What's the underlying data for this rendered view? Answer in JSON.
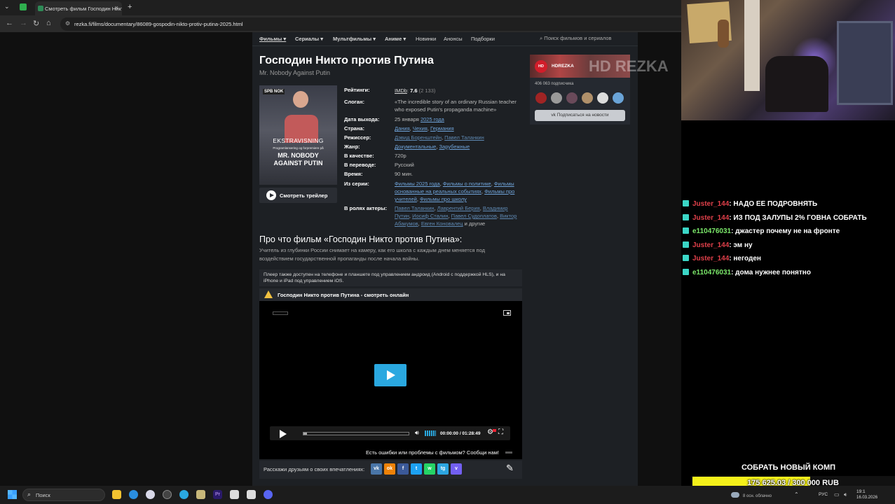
{
  "browser": {
    "tab_title": "Смотреть фильм Господин Никто",
    "url": "rezka.fi/films/documentary/86089-gospodin-nikto-protiv-putina-2025.html",
    "new_tab": "+",
    "tab_close": "×"
  },
  "site": {
    "nav": [
      {
        "label": "Фильмы ▾",
        "bold": true,
        "active": true
      },
      {
        "label": "Сериалы ▾",
        "bold": true
      },
      {
        "label": "Мультфильмы ▾",
        "bold": true
      },
      {
        "label": "Аниме ▾",
        "bold": true
      },
      {
        "label": "Новинки"
      },
      {
        "label": "Анонсы"
      },
      {
        "label": "Подборки"
      }
    ],
    "search_placeholder": "Поиск фильмов и сериалов",
    "title": "Господин Никто против Путина",
    "original_title": "Mr. Nobody Against Putin",
    "poster": {
      "channel": "SPB NOK",
      "line1": "EKSTRAVISNING",
      "line2": "Programlansering og forpremiere på",
      "line3a": "MR. NOBODY",
      "line3b": "AGAINST PUTIN"
    },
    "trailer_button": "Смотреть трейлер",
    "info": {
      "ratings_label": "Рейтинги:",
      "imdb_label": "IMDb",
      "imdb_score": "7.6",
      "imdb_votes": "(2 133)",
      "slogan_label": "Слоган:",
      "slogan": "«The incredible story of an ordinary Russian teacher who exposed Putin's propaganda machine»",
      "date_label": "Дата выхода:",
      "date_day": "25 января",
      "date_year": "2025 года",
      "country_label": "Страна:",
      "countries": [
        "Дания",
        "Чехия",
        "Германия"
      ],
      "director_label": "Режиссер:",
      "directors": [
        "Дэвид Боренштейн",
        "Павел Таланкин"
      ],
      "genre_label": "Жанр:",
      "genres": [
        "Документальные",
        "Зарубежные"
      ],
      "quality_label": "В качестве:",
      "quality": "720p",
      "translation_label": "В переводе:",
      "translation": "Русский",
      "time_label": "Время:",
      "time": "90 мин.",
      "series_label": "Из серии:",
      "series": [
        "Фильмы 2025 года",
        "Фильмы о политике",
        "Фильмы основанные на реальных событиях",
        "Фильмы про учителей",
        "Фильмы про школу"
      ],
      "cast_label": "В ролях актеры:",
      "cast": [
        "Павел Таланкин",
        "Лаврентий Берия",
        "Владимир Путин",
        "Иосиф Сталин",
        "Павел Судоплатов",
        "Виктор Абакумов",
        "Евген Коновалец"
      ],
      "cast_tail": "и другие"
    },
    "about_title": "Про что фильм «Господин Никто против Путина»:",
    "about_text": "Учитель из глубинки России снимает на камеру, как его школа с каждым днем меняется под воздействием государственной пропаганды после начала войны.",
    "player_note": "Плеер также доступен на телефоне и планшете под управлением андроид (Android с поддержкой HLS), и на iPhone и iPad под управлением iOS.",
    "player_title": "Господин Никто против Путина - смотреть онлайн",
    "player_time": "00:00:00 / 01:28:49",
    "report": "Есть ошибки или проблемы с фильмом? Сообщи нам!",
    "share_label": "Расскажи друзьям о своих впечатлениях:",
    "share": [
      {
        "label": "vk",
        "color": "#4a76a8"
      },
      {
        "label": "ok",
        "color": "#ee8208"
      },
      {
        "label": "f",
        "color": "#3b5998"
      },
      {
        "label": "t",
        "color": "#1da1f2"
      },
      {
        "label": "w",
        "color": "#25d366"
      },
      {
        "label": "tg",
        "color": "#2ca5e0"
      },
      {
        "label": "v",
        "color": "#7360f2"
      }
    ],
    "card": {
      "name": "HDREZKA",
      "logo": "HD REZKA",
      "subscribers": "406 063 подписчика",
      "subscribe_button": "Подписаться на новости"
    }
  },
  "chat": [
    {
      "user": "Juster_144",
      "color": "red",
      "text": ": НАДО ЕЕ ПОДРОВНЯТЬ"
    },
    {
      "user": "Juster_144",
      "color": "red",
      "text": ": ИЗ ПОД ЗАЛУПЫ 2% ГОВНА СОБРАТЬ"
    },
    {
      "user": "e110476031",
      "color": "green",
      "text": ": джастер почему не на фронте"
    },
    {
      "user": "Juster_144",
      "color": "red",
      "text": ": эм ну"
    },
    {
      "user": "Juster_144",
      "color": "red",
      "text": ": негоден"
    },
    {
      "user": "e110476031",
      "color": "green",
      "text": ": дома нужнее понятно"
    }
  ],
  "goal": {
    "title": "СОБРАТЬ НОВЫЙ КОМП",
    "text": "175 625.03 / 300 000 RUB",
    "progress": 0.585
  },
  "taskbar": {
    "search": "Поиск",
    "weather": "8 осн. облачно",
    "lang": "РУС",
    "time": "19:1",
    "date": "16.03.2026"
  }
}
